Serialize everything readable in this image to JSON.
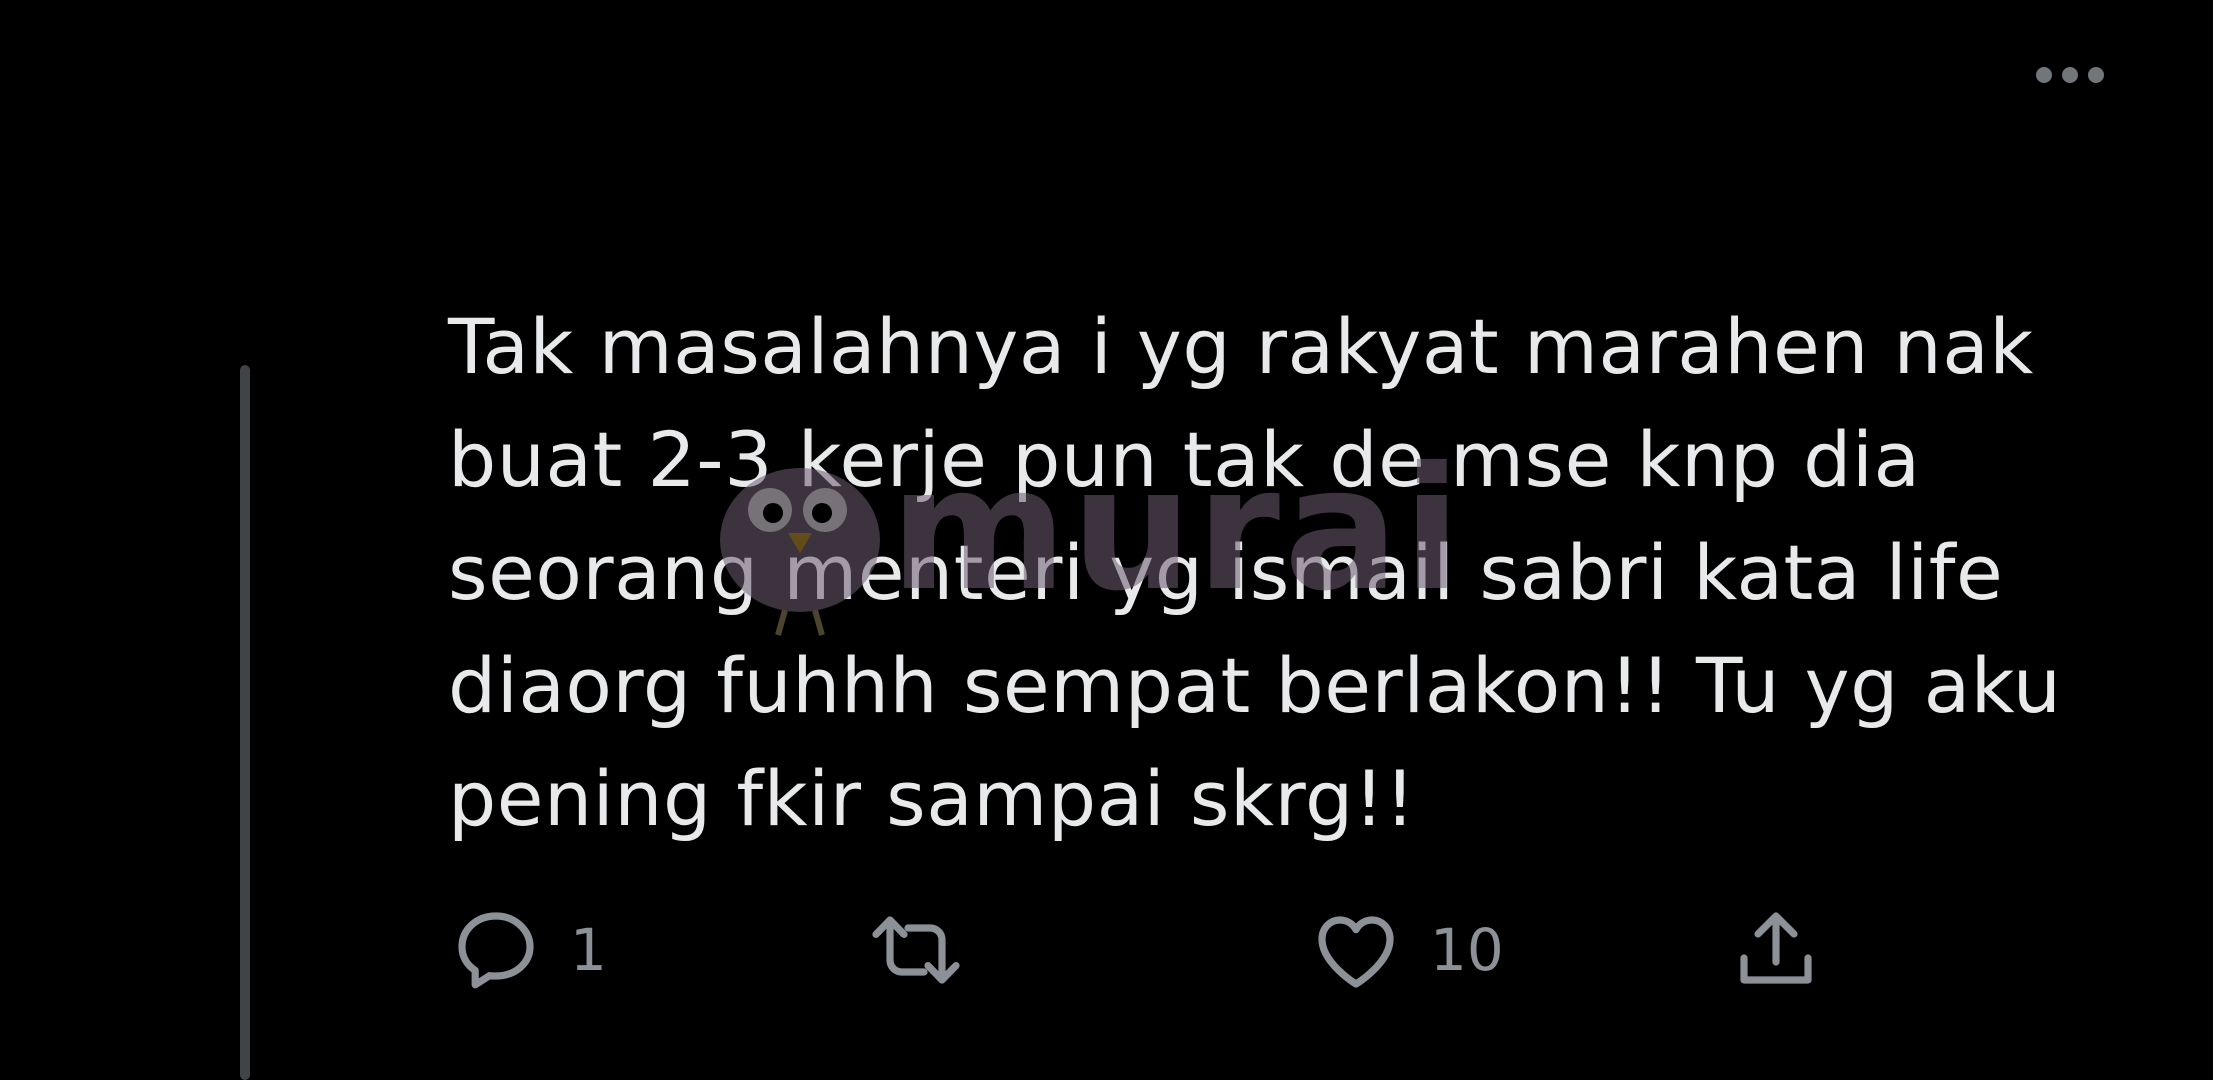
{
  "tweet": {
    "text_lines": [
      "Tak masalahnya i yg rakyat marahen nak",
      "buat 2-3 kerje pun tak de mse knp dia",
      "seorang menteri yg ismail sabri kata life",
      "diaorg fuhhh sempat berlakon!! Tu yg aku",
      "pening fkir sampai skrg!!"
    ],
    "more_icon": "more-horizontal-icon"
  },
  "actions": {
    "reply": {
      "icon": "reply-icon",
      "count": "1"
    },
    "retweet": {
      "icon": "retweet-icon"
    },
    "like": {
      "icon": "heart-icon",
      "count": "10"
    },
    "share": {
      "icon": "share-icon"
    }
  },
  "watermark": {
    "text": "murai"
  },
  "colors": {
    "background": "#000000",
    "text": "#e7e9ea",
    "icon": "#8b9196",
    "thread_line": "#3f4448",
    "watermark": "#6e5d73"
  }
}
